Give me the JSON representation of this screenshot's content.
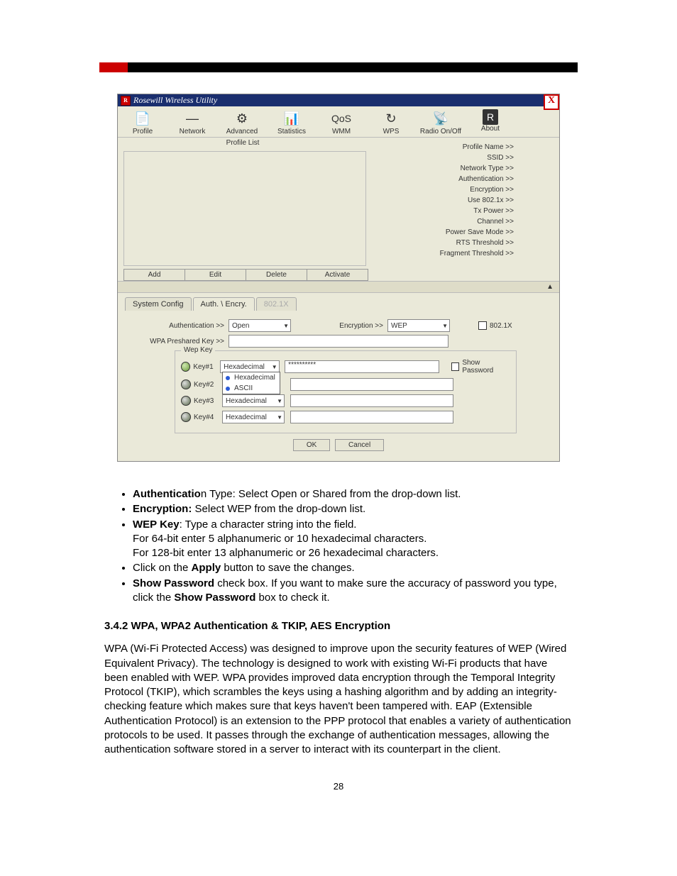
{
  "app": {
    "title": "Rosewill Wireless Utility",
    "close": "X",
    "tools": [
      {
        "label": "Profile",
        "glyph": "📄"
      },
      {
        "label": "Network",
        "glyph": "—"
      },
      {
        "label": "Advanced",
        "glyph": "⚙"
      },
      {
        "label": "Statistics",
        "glyph": "📊"
      },
      {
        "label": "WMM",
        "glyph": "QoS"
      },
      {
        "label": "WPS",
        "glyph": "↻"
      },
      {
        "label": "Radio On/Off",
        "glyph": "📡"
      },
      {
        "label": "About",
        "glyph": "R"
      }
    ],
    "profile_list_header": "Profile List",
    "actions": [
      "Add",
      "Edit",
      "Delete",
      "Activate"
    ],
    "details": [
      "Profile Name >>",
      "SSID >>",
      "Network Type >>",
      "Authentication >>",
      "Encryption >>",
      "Use 802.1x >>",
      "Tx Power >>",
      "Channel >>",
      "Power Save Mode >>",
      "RTS Threshold >>",
      "Fragment Threshold >>"
    ],
    "collapse": "▲",
    "tabs": {
      "sys": "System Config",
      "auth": "Auth. \\ Encry.",
      "dot1x": "802.1X"
    },
    "form": {
      "auth_label": "Authentication >>",
      "auth_value": "Open",
      "enc_label": "Encryption >>",
      "enc_value": "WEP",
      "dot1x": "802.1X",
      "wpa_label": "WPA Preshared Key >>",
      "wepkey_legend": "Wep Key",
      "keys": [
        {
          "label": "Key#1",
          "mode": "Hexadecimal",
          "value": "**********",
          "on": true
        },
        {
          "label": "Key#2",
          "mode": "Hexadecimal",
          "value": "",
          "on": false
        },
        {
          "label": "Key#3",
          "mode": "Hexadecimal",
          "value": "",
          "on": false
        },
        {
          "label": "Key#4",
          "mode": "Hexadecimal",
          "value": "",
          "on": false
        }
      ],
      "dd_options": [
        "Hexadecimal",
        "ASCII"
      ],
      "showpw": "Show Password",
      "ok": "OK",
      "cancel": "Cancel"
    }
  },
  "doc": {
    "b1a": "Authenticatio",
    "b1b": "n Type: Select Open or Shared from the drop-down list.",
    "b2a": "Encryption:",
    "b2b": " Select WEP from the drop-down list.",
    "b3a": "WEP Key",
    "b3b": ": Type a character string into the field.",
    "b3c": "For 64-bit enter 5 alphanumeric or 10 hexadecimal characters.",
    "b3d": "For 128-bit enter 13 alphanumeric or 26 hexadecimal characters.",
    "b4a": "Click on the ",
    "b4b": "Apply",
    "b4c": " button to save the changes.",
    "b5a": "Show Password",
    "b5b": " check box. If you want to make sure the accuracy of password you type, click the ",
    "b5c": "Show Password",
    "b5d": " box to check it.",
    "sect": "3.4.2  WPA, WPA2 Authentication & TKIP, AES Encryption",
    "para": "WPA (Wi-Fi Protected Access) was designed to improve upon the security features of WEP (Wired Equivalent Privacy).  The technology is designed to work with existing Wi-Fi products that have been enabled with WEP.  WPA provides improved data encryption through the Temporal Integrity Protocol (TKIP), which scrambles the keys using a hashing algorithm and by adding an integrity-checking feature which makes sure that keys haven't been tampered with. EAP (Extensible Authentication Protocol) is an extension to the PPP protocol that enables a variety of authentication protocols to be used. It passes through the exchange of authentication messages, allowing the authentication software stored in a server to interact with its counterpart in the client.",
    "pagenum": "28"
  }
}
